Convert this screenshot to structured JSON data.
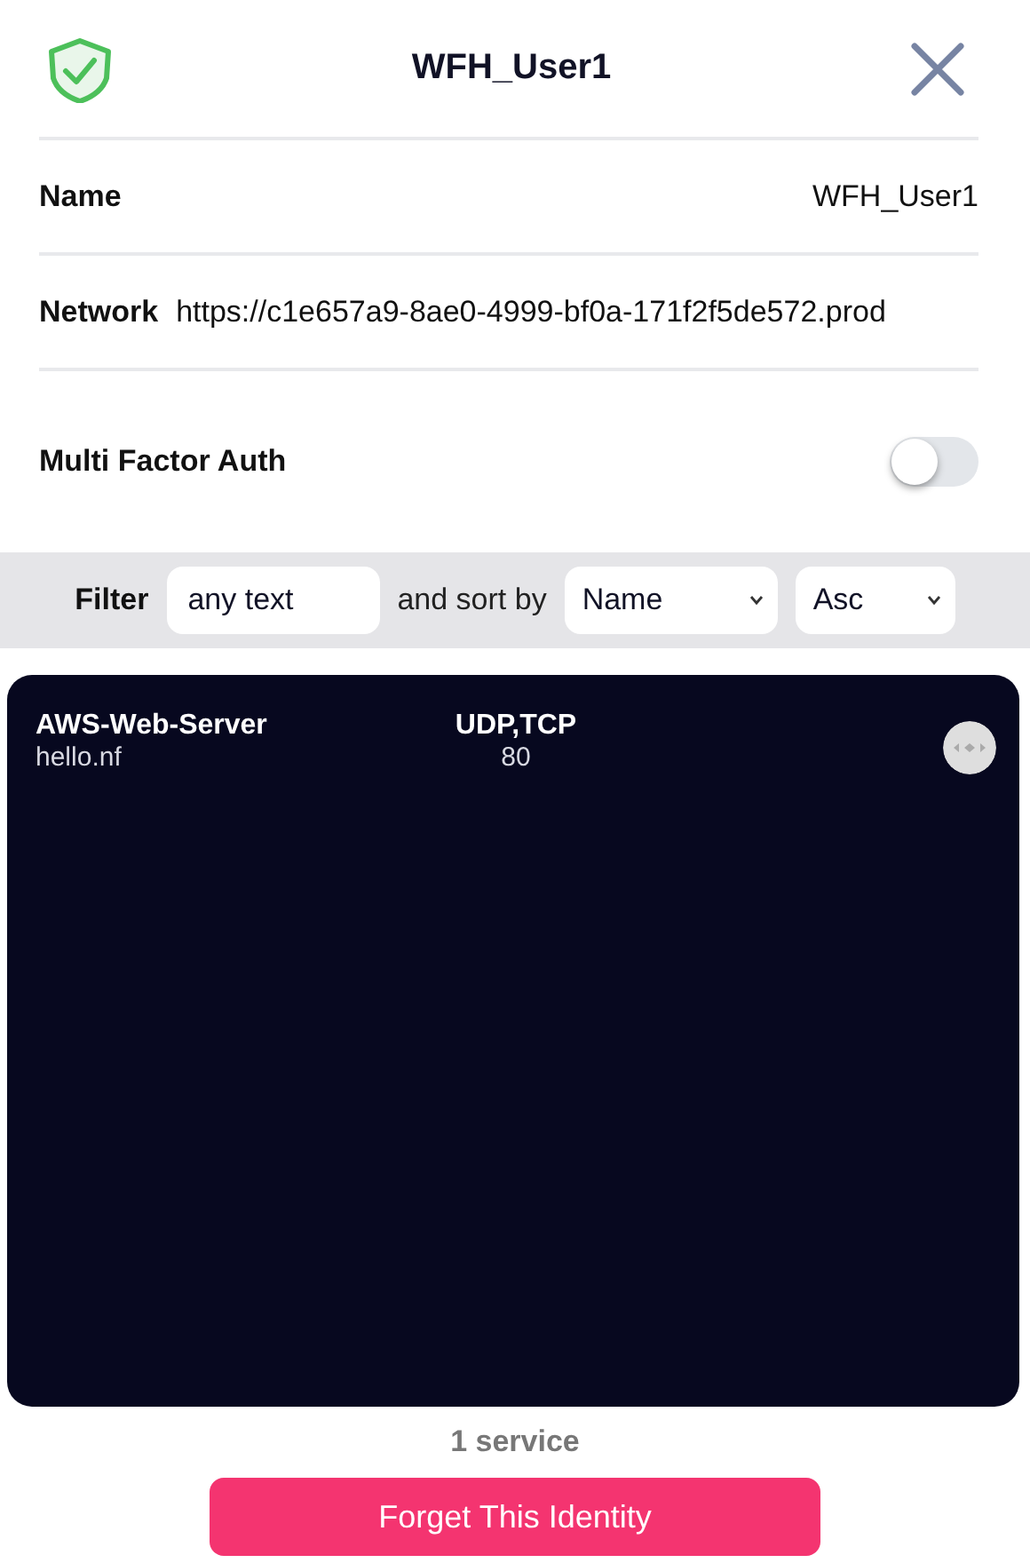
{
  "header": {
    "title": "WFH_User1"
  },
  "details": [
    {
      "label": "Name",
      "value": "WFH_User1",
      "kind": "right"
    },
    {
      "label": "Network",
      "value": "https://c1e657a9-8ae0-4999-bf0a-171f2f5de572.prod",
      "kind": "left"
    }
  ],
  "mfa": {
    "label": "Multi Factor Auth",
    "on": false
  },
  "filter": {
    "label": "Filter",
    "placeholder": "any text",
    "sort_label": "and sort by",
    "sort_field": "Name",
    "sort_order": "Asc"
  },
  "services": [
    {
      "name": "AWS-Web-Server",
      "address": "hello.nf",
      "protocols": "UDP,TCP",
      "ports": "80"
    }
  ],
  "count": "1 service",
  "forget_button": "Forget This Identity"
}
